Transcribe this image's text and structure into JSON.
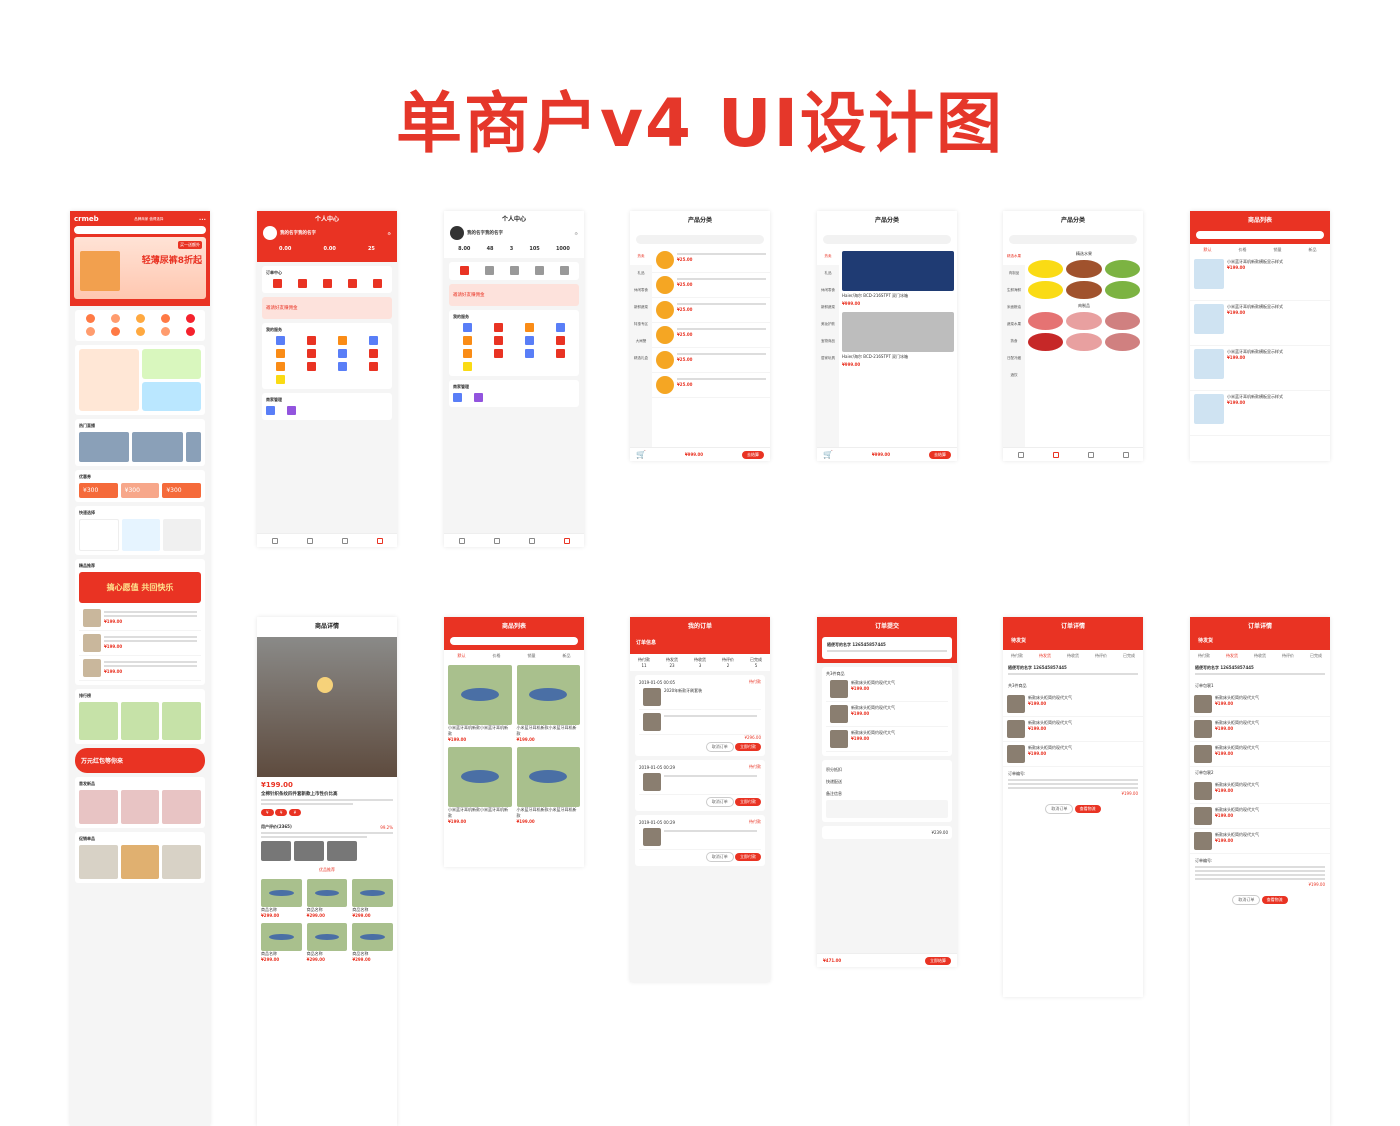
{
  "page_title": "单商户v4 UI设计图",
  "home": {
    "logo": "crmeb",
    "tagline": "品牌商家 值得选择",
    "banner": "轻薄尿裤8折起",
    "promo": "买一送额外",
    "sections": [
      "热门直播",
      "优惠券",
      "快速选择",
      "精品推荐",
      "排行榜",
      "首发新品",
      "促销单品"
    ],
    "coupons": [
      "¥300",
      "¥300",
      "¥300"
    ],
    "recommend": "搞心愿值 共回快乐",
    "redpack": "万元红包等你来",
    "price": "¥199.00",
    "tags": [
      "新品",
      "新品",
      "新品"
    ]
  },
  "me": {
    "title": "个人中心",
    "name": "我的名字我的名字",
    "stats": [
      "0.00",
      "0.00",
      "25"
    ],
    "order_center": "订单中心",
    "service": "我的服务",
    "merchant": "商家管理",
    "invite": "邀请好友赚佣金"
  },
  "me2": {
    "title": "个人中心",
    "name": "我的名字我的名字",
    "stats": [
      "8.00",
      "48",
      "3",
      "105",
      "1000"
    ]
  },
  "cat1": {
    "title": "产品分类",
    "cats": [
      "热卖",
      "礼品",
      "休闲零食",
      "新鲜蔬菜",
      "特惠专区",
      "大闸蟹",
      "精选礼盒"
    ],
    "price": "¥25.00",
    "total": "¥999.00",
    "pay": "去结算"
  },
  "cat2": {
    "title": "产品分类",
    "cats": [
      "热卖",
      "礼品",
      "休闲零食",
      "新鲜蔬菜",
      "美妆护肤",
      "宝物商品",
      "居家玩具"
    ],
    "desc": "Haier/海尔 BCD-216STPT 双门冰箱",
    "price": "¥999.00",
    "total": "¥999.00",
    "pay": "去结算"
  },
  "cat3": {
    "title": "产品分类",
    "section1": "精选水果",
    "section2": "肉制品",
    "cats": [
      "精选水果",
      "肉制品",
      "生鲜海鲜",
      "米面粮油",
      "蔬菜水果",
      "熟食",
      "日配冷藏",
      "酒饮"
    ]
  },
  "list1": {
    "title": "商品列表",
    "filters": [
      "默认",
      "价格",
      "销量",
      "新品"
    ],
    "name": "小米蓝牙耳机新款横板显示样式",
    "price": "¥199.00"
  },
  "detail": {
    "title": "商品详情",
    "price": "¥199.00",
    "name": "全棉针织条纹四件套新款上市性价比高",
    "review": "用户评价(2365)",
    "rate": "99.2%",
    "recommend": "优品推荐",
    "good_price": "¥299.00",
    "good_name": "商品名称"
  },
  "list2": {
    "title": "商品列表",
    "filters": [
      "默认",
      "价格",
      "销量",
      "新品"
    ],
    "name": "小米蓝牙耳机新款小米蓝牙耳机新款",
    "price": "¥199.00"
  },
  "orders": {
    "title": "我的订单",
    "info": "订单信息",
    "tabs": [
      "待付款",
      "待发货",
      "待收货",
      "待评价",
      "已完成"
    ],
    "counts": [
      "11",
      "23",
      "3",
      "2",
      "5"
    ],
    "date1": "2019-01-05 00:05",
    "date2": "2019-01-05 00:29",
    "status": "待付款",
    "item": "2020年新款牙刷套装",
    "total": "¥296.00",
    "cancel": "取消订单",
    "pay": "立即付款"
  },
  "submit": {
    "title": "订单提交",
    "addr": "随便写的名字  126545857445",
    "count": "共3件商品",
    "item": "新款床头柜简约现代大气",
    "price": "¥199.00",
    "points": "积分抵扣",
    "ship": "快递配送",
    "note": "备注信息",
    "sum": "¥239.00",
    "total": "¥471.00",
    "submit": "立即结算"
  },
  "od1": {
    "title": "订单详情",
    "status": "待发货",
    "steps": [
      "待付款",
      "待发货",
      "待收货",
      "待评价",
      "已完成"
    ],
    "addr": "随便写的名字  126545857445",
    "count": "共3件商品",
    "item": "新款床头柜简约现代大气",
    "price": "¥199.00",
    "ordno": "订单编号:",
    "cancel": "取消订单",
    "logi": "查看物流",
    "paid": "¥199.00"
  },
  "od2": {
    "title": "订单详情",
    "status": "待发货",
    "pkg1": "订单包裹1",
    "pkg2": "订单包裹2",
    "item": "新款床头柜简约现代大气",
    "price": "¥199.00",
    "cancel": "取消订单",
    "logi": "查看物流",
    "paid": "¥199.00"
  }
}
